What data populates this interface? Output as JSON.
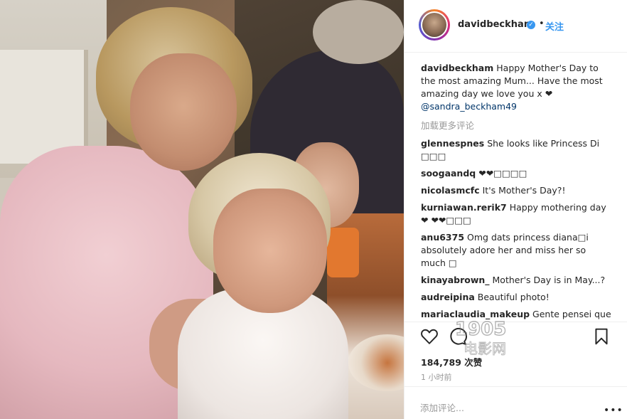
{
  "header": {
    "username": "davidbeckham",
    "verified_icon": "verified-badge-icon",
    "separator": "•",
    "follow_label": "关注"
  },
  "caption": {
    "username": "davidbeckham",
    "text": "Happy Mother's Day to the most amazing Mum... Have the most amazing day we love you x ❤",
    "mention": "@sandra_beckham49"
  },
  "load_more_label": "加载更多评论",
  "comments": [
    {
      "user": "glennespnes",
      "text": "She looks like Princess Di □□□"
    },
    {
      "user": "soogaandq",
      "text": "❤❤□□□□"
    },
    {
      "user": "nicolasmcfc",
      "text": "It's Mother's Day?!"
    },
    {
      "user": "kurniawan.rerik7",
      "text": "Happy mothering day ❤ ❤❤□□□"
    },
    {
      "user": "anu6375",
      "text": "Omg dats princess diana□i absolutely adore her and miss her so much □"
    },
    {
      "user": "kinayabrown_",
      "text": "Mother's Day is in May...?"
    },
    {
      "user": "audreipina",
      "text": "Beautiful photo!"
    },
    {
      "user": "mariaclaudia_makeup",
      "text": "Gente pensei que"
    }
  ],
  "actions": {
    "like_icon": "heart-icon",
    "comment_icon": "comment-bubble-icon",
    "save_icon": "bookmark-icon"
  },
  "likes_text": "184,789 次赞",
  "timestamp": "1 小时前",
  "add_comment_placeholder": "添加评论...",
  "more_options_label": "•••",
  "watermark_text_top": "1905",
  "watermark_text_bottom": "电影网",
  "colors": {
    "link_blue": "#3897f0",
    "mention_blue": "#003569",
    "text": "#262626",
    "muted": "#999999",
    "border": "#efefef"
  }
}
